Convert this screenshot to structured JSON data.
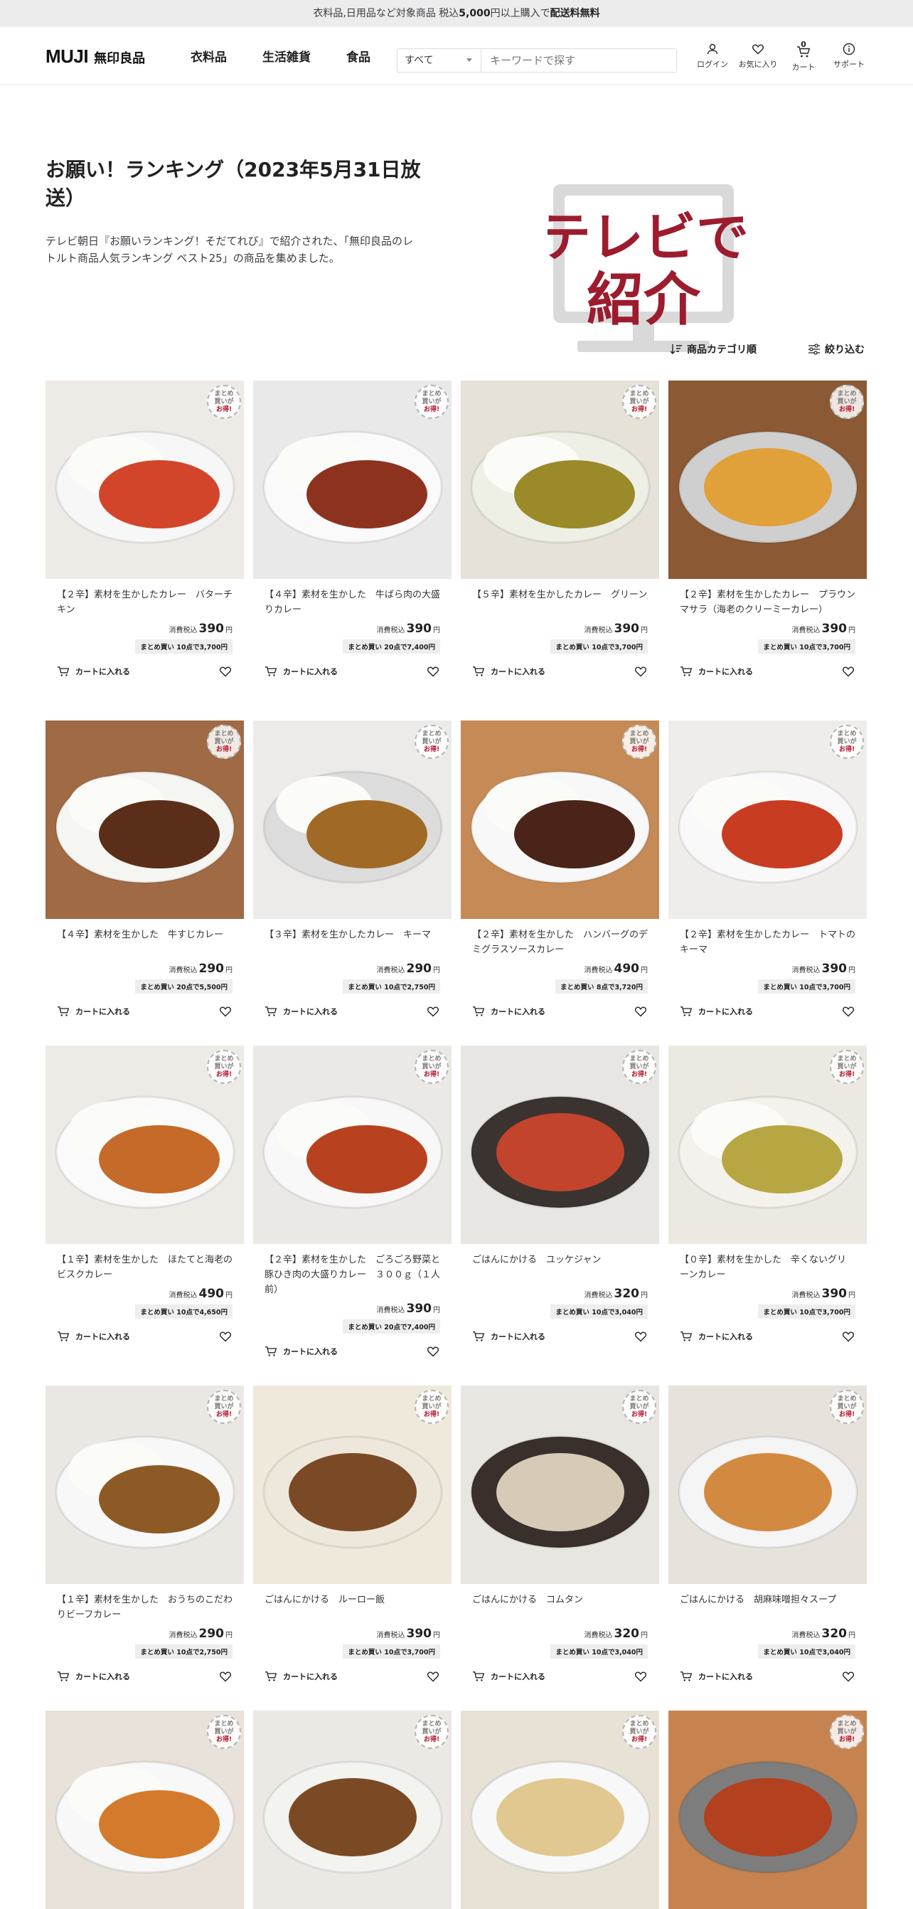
{
  "promo": {
    "text_pre": "衣料品,日用品など対象商品 税込",
    "amount": "5,000",
    "text_mid": "円以上購入で",
    "text_bold": "配送料無料"
  },
  "header": {
    "logo_mark": "MUJI",
    "logo_text": "無印良品",
    "nav": [
      "衣料品",
      "生活雑貨",
      "食品"
    ],
    "search_select": "すべて",
    "search_placeholder": "キーワードで探す",
    "icons": [
      {
        "label": "ログイン",
        "icon": "user-icon"
      },
      {
        "label": "お気に入り",
        "icon": "heart-icon"
      },
      {
        "label": "カート",
        "icon": "cart-icon",
        "count": "0"
      },
      {
        "label": "サポート",
        "icon": "info-icon"
      }
    ]
  },
  "hero": {
    "title": "お願い！ランキング（2023年5月31日放送）",
    "description": "テレビ朝日『お願いランキング！そだてれび』で紹介された、「無印良品のレトルト商品人気ランキング ベスト25」の商品を集めました。",
    "tv_line1": "テレビで",
    "tv_line2": "紹介",
    "accent": "#9c1c2e"
  },
  "tools": {
    "category": "商品カテゴリ順",
    "filter": "絞り込む"
  },
  "common": {
    "tax_label": "消費税込",
    "yen": "円",
    "cart_label": "カートに入れる",
    "badge1": "まとめ",
    "badge2": "買いが",
    "badge3": "お得!"
  },
  "products": [
    {
      "title": "【２辛】素材を生かしたカレー　バターチキン",
      "price": "390",
      "bulk": "まとめ買い 10点で3,700円",
      "bg": "#eeeae6",
      "plate": "#f7f7f7",
      "food": "#d2452a",
      "rice": true
    },
    {
      "title": "【４辛】素材を生かした　牛ばら肉の大盛りカレー",
      "price": "390",
      "bulk": "まとめ買い 20点で7,400円",
      "bg": "#e9e9ea",
      "plate": "#fafafa",
      "food": "#8e3220",
      "rice": true
    },
    {
      "title": "【５辛】素材を生かしたカレー　グリーン",
      "price": "390",
      "bulk": "まとめ買い 10点で3,700円",
      "bg": "#e7e2d8",
      "plate": "#eef0e6",
      "food": "#9b8a2a",
      "rice": true
    },
    {
      "title": "【２辛】素材を生かしたカレー　プラウンマサラ（海老のクリーミーカレー）",
      "price": "390",
      "bulk": "まとめ買い 10点で3,700円",
      "bg": "#8b5a34",
      "plate": "#cfcfcf",
      "food": "#e0a03a",
      "rice": false
    },
    {
      "title": "【４辛】素材を生かした　牛すじカレー",
      "price": "290",
      "bulk": "まとめ買い 20点で5,500円",
      "bg": "#a06a44",
      "plate": "#f5f5f2",
      "food": "#5a2e18",
      "rice": true
    },
    {
      "title": "【３辛】素材を生かしたカレー　キーマ",
      "price": "290",
      "bulk": "まとめ買い 10点で2,750円",
      "bg": "#ecebe9",
      "plate": "#dcdcdc",
      "food": "#a06a26",
      "rice": true
    },
    {
      "title": "【２辛】素材を生かした　ハンバーグのデミグラスソースカレー",
      "price": "490",
      "bulk": "まとめ買い 8点で3,720円",
      "bg": "#c58a55",
      "plate": "#f8f8f8",
      "food": "#4a2418",
      "rice": true
    },
    {
      "title": "【２辛】素材を生かしたカレー　トマトのキーマ",
      "price": "390",
      "bulk": "まとめ買い 10点で3,700円",
      "bg": "#efedea",
      "plate": "#f9f9f9",
      "food": "#c83c22",
      "rice": true
    },
    {
      "title": "【１辛】素材を生かした　ほたてと海老のビスクカレー",
      "price": "490",
      "bulk": "まとめ買い 10点で4,650円",
      "bg": "#ecebe6",
      "plate": "#fafafa",
      "food": "#c56a28",
      "rice": true
    },
    {
      "title": "【２辛】素材を生かした　ごろごろ野菜と豚ひき肉の大盛りカレー　３００ｇ（１人前）",
      "price": "390",
      "bulk": "まとめ買い 20点で7,400円",
      "bg": "#ebe9e6",
      "plate": "#f8f8f8",
      "food": "#b8421f",
      "rice": true
    },
    {
      "title": "ごはんにかける　ユッケジャン",
      "price": "320",
      "bulk": "まとめ買い 10点で3,040円",
      "bg": "#e8e6e2",
      "plate": "#3a3330",
      "food": "#c2442c",
      "rice": false
    },
    {
      "title": "【０辛】素材を生かした　辛くないグリーンカレー",
      "price": "390",
      "bulk": "まとめ買い 10点で3,700円",
      "bg": "#ece9e2",
      "plate": "#f4f2ec",
      "food": "#b7a742",
      "rice": true
    },
    {
      "title": "【１辛】素材を生かした　おうちのこだわりビーフカレー",
      "price": "290",
      "bulk": "まとめ買い 10点で2,750円",
      "bg": "#ebe8e4",
      "plate": "#f8f8f8",
      "food": "#8d5a26",
      "rice": true
    },
    {
      "title": "ごはんにかける　ルーロー飯",
      "price": "390",
      "bulk": "まとめ買い 10点で3,700円",
      "bg": "#efe9dc",
      "plate": "#eee8dc",
      "food": "#7a4a26",
      "rice": false
    },
    {
      "title": "ごはんにかける　コムタン",
      "price": "320",
      "bulk": "まとめ買い 10点で3,040円",
      "bg": "#e8e6e1",
      "plate": "#3a302b",
      "food": "#d7cbb8",
      "rice": false
    },
    {
      "title": "ごはんにかける　胡麻味噌担々スープ",
      "price": "320",
      "bulk": "まとめ買い 10点で3,040円",
      "bg": "#e7e3dc",
      "plate": "#f5f5f5",
      "food": "#d28a40",
      "rice": false
    },
    {
      "bg": "#e8e2da",
      "plate": "#f8f8f8",
      "food": "#d47a2c",
      "rice": true
    },
    {
      "bg": "#ece9e4",
      "plate": "#f3f3f0",
      "food": "#7a4a24",
      "rice": false
    },
    {
      "bg": "#e7e1d6",
      "plate": "#f8f8f8",
      "food": "#e0c890",
      "rice": false
    },
    {
      "bg": "#c7834f",
      "plate": "#7d7d7d",
      "food": "#b3401e",
      "rice": false
    }
  ]
}
